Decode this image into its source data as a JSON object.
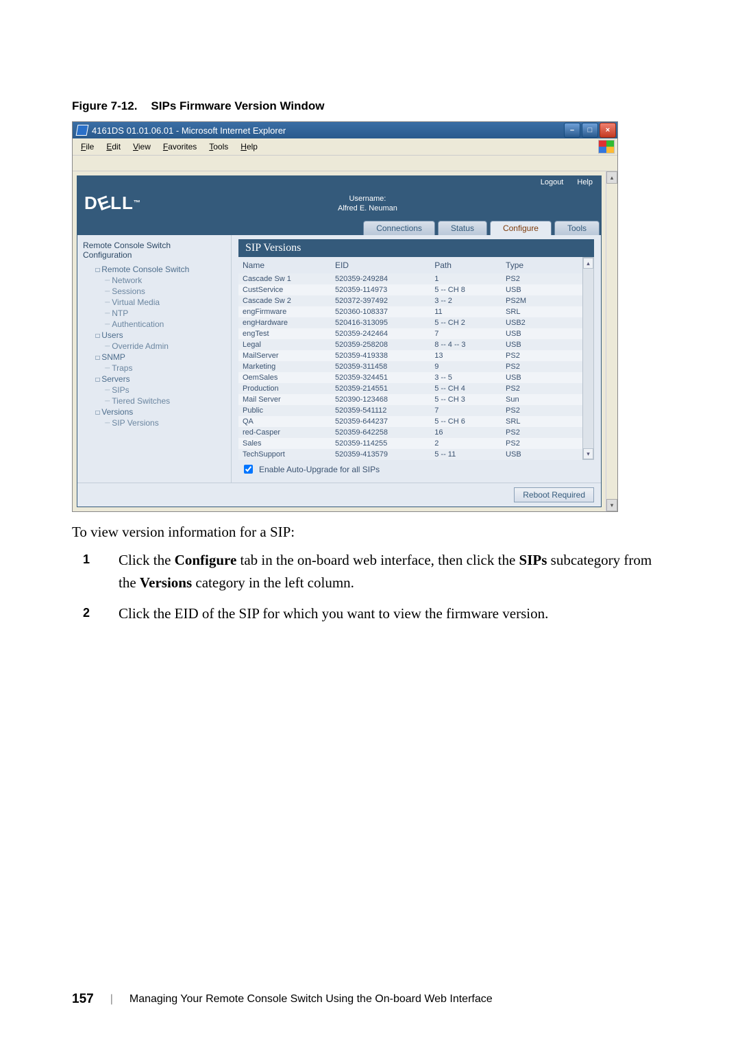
{
  "figure": {
    "label": "Figure 7-12.",
    "title": "SIPs Firmware Version Window"
  },
  "browser": {
    "title": "4161DS 01.01.06.01 - Microsoft Internet Explorer",
    "menus": [
      "File",
      "Edit",
      "View",
      "Favorites",
      "Tools",
      "Help"
    ],
    "win_buttons": {
      "minimize": "–",
      "maximize": "□",
      "close": "×"
    }
  },
  "topbar": {
    "logout": "Logout",
    "help": "Help"
  },
  "brand": {
    "logo_text": "DELL",
    "username_label": "Username:",
    "username": "Alfred E. Neuman"
  },
  "tabs": [
    "Connections",
    "Status",
    "Configure",
    "Tools"
  ],
  "active_tab": "Configure",
  "left": {
    "title_line1": "Remote Console Switch",
    "title_line2": "Configuration",
    "tree": [
      {
        "lvl": 1,
        "exp": "☐",
        "label": "Remote Console Switch"
      },
      {
        "lvl": 2,
        "label": "Network"
      },
      {
        "lvl": 2,
        "label": "Sessions"
      },
      {
        "lvl": 2,
        "label": "Virtual Media"
      },
      {
        "lvl": 2,
        "label": "NTP"
      },
      {
        "lvl": 2,
        "label": "Authentication"
      },
      {
        "lvl": 1,
        "exp": "☐",
        "label": "Users"
      },
      {
        "lvl": 2,
        "label": "Override Admin"
      },
      {
        "lvl": 1,
        "exp": "☐",
        "label": "SNMP"
      },
      {
        "lvl": 2,
        "label": "Traps"
      },
      {
        "lvl": 1,
        "exp": "☐",
        "label": "Servers"
      },
      {
        "lvl": 2,
        "label": "SIPs"
      },
      {
        "lvl": 2,
        "label": "Tiered Switches"
      },
      {
        "lvl": 1,
        "exp": "☐",
        "label": "Versions"
      },
      {
        "lvl": 2,
        "label": "SIP Versions"
      }
    ]
  },
  "panel": {
    "title": "SIP Versions"
  },
  "columns": [
    "Name",
    "EID",
    "Path",
    "Type"
  ],
  "rows": [
    {
      "name": "Cascade Sw 1",
      "eid": "520359-249284",
      "path": "1",
      "type": "PS2"
    },
    {
      "name": "CustService",
      "eid": "520359-114973",
      "path": "5 -- CH 8",
      "type": "USB"
    },
    {
      "name": "Cascade Sw 2",
      "eid": "520372-397492",
      "path": "3 -- 2",
      "type": "PS2M"
    },
    {
      "name": "engFirmware",
      "eid": "520360-108337",
      "path": "11",
      "type": "SRL"
    },
    {
      "name": "engHardware",
      "eid": "520416-313095",
      "path": "5 -- CH 2",
      "type": "USB2"
    },
    {
      "name": "engTest",
      "eid": "520359-242464",
      "path": "7",
      "type": "USB"
    },
    {
      "name": "Legal",
      "eid": "520359-258208",
      "path": "8 -- 4 -- 3",
      "type": "USB"
    },
    {
      "name": "MailServer",
      "eid": "520359-419338",
      "path": "13",
      "type": "PS2"
    },
    {
      "name": "Marketing",
      "eid": "520359-311458",
      "path": "9",
      "type": "PS2"
    },
    {
      "name": "OemSales",
      "eid": "520359-324451",
      "path": "3 -- 5",
      "type": "USB"
    },
    {
      "name": "Production",
      "eid": "520359-214551",
      "path": "5 -- CH 4",
      "type": "PS2"
    },
    {
      "name": "Mail Server",
      "eid": "520390-123468",
      "path": "5 -- CH 3",
      "type": "Sun"
    },
    {
      "name": "Public",
      "eid": "520359-541112",
      "path": "7",
      "type": "PS2"
    },
    {
      "name": "QA",
      "eid": "520359-644237",
      "path": "5 -- CH 6",
      "type": "SRL"
    },
    {
      "name": "red-Casper",
      "eid": "520359-642258",
      "path": "16",
      "type": "PS2"
    },
    {
      "name": "Sales",
      "eid": "520359-114255",
      "path": "2",
      "type": "PS2"
    },
    {
      "name": "TechSupport",
      "eid": "520359-413579",
      "path": "5 -- 11",
      "type": "USB"
    }
  ],
  "checkbox": {
    "checked": true,
    "label": "Enable Auto-Upgrade for all SIPs"
  },
  "reboot_button": "Reboot Required",
  "body_text": "To view version information for a SIP:",
  "steps": [
    "Click the Configure tab in the on-board web interface, then click the SIPs subcategory from the Versions category in the left column.",
    "Click the EID of the SIP for which you want to view the firmware version."
  ],
  "step_bold": {
    "0": [
      "Configure",
      "SIPs",
      "Versions"
    ]
  },
  "footer": {
    "page": "157",
    "chapter": "Managing Your Remote Console Switch Using the On-board Web Interface"
  }
}
